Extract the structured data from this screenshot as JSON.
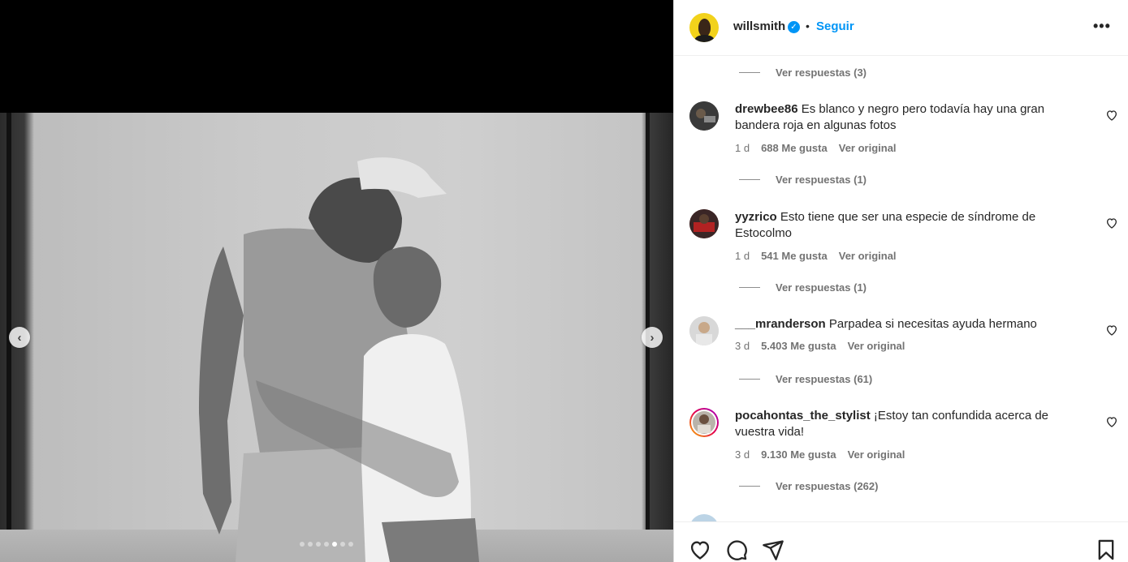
{
  "post": {
    "username": "willsmith",
    "follow_label": "Seguir",
    "separator": "•",
    "verified_icon": "verified-badge-icon",
    "more_icon": "more-options-icon"
  },
  "carousel": {
    "prev_icon": "chevron-left-icon",
    "next_icon": "chevron-right-icon",
    "slide_count": 7,
    "active_slide": 5
  },
  "comments": [
    {
      "replies_label": "Ver respuestas (3)"
    },
    {
      "username": "drewbee86",
      "text": "Es blanco y negro pero todavía hay una gran bandera roja en algunas fotos",
      "age": "1 d",
      "likes": "688 Me gusta",
      "see_original": "Ver original",
      "replies_label": "Ver respuestas (1)"
    },
    {
      "username": "yyzrico",
      "text": "Esto tiene que ser una especie de síndrome de Estocolmo",
      "age": "1 d",
      "likes": "541 Me gusta",
      "see_original": "Ver original",
      "replies_label": "Ver respuestas (1)"
    },
    {
      "username": "___mranderson",
      "text": "Parpadea si necesitas ayuda hermano",
      "age": "3 d",
      "likes": "5.403 Me gusta",
      "see_original": "Ver original",
      "replies_label": "Ver respuestas (61)"
    },
    {
      "username": "pocahontas_the_stylist",
      "text": "¡Estoy tan confundida acerca de vuestra vida!",
      "age": "3 d",
      "likes": "9.130 Me gusta",
      "see_original": "Ver original",
      "replies_label": "Ver respuestas (262)"
    }
  ],
  "actions": {
    "like_icon": "heart-icon",
    "comment_icon": "comment-icon",
    "share_icon": "share-icon",
    "save_icon": "bookmark-icon"
  }
}
